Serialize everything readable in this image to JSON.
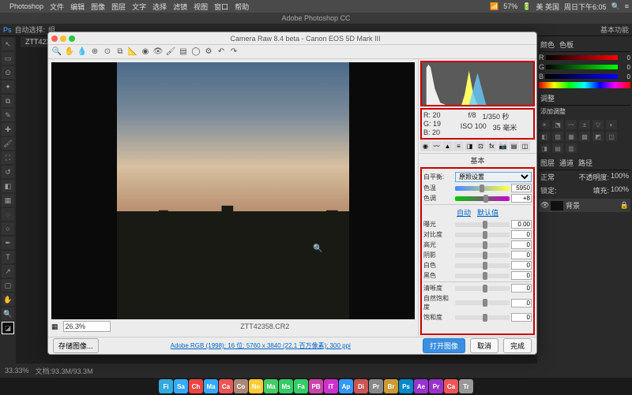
{
  "menubar": {
    "app": "Photoshop",
    "items": [
      "文件",
      "编辑",
      "图像",
      "图层",
      "文字",
      "选择",
      "滤镜",
      "视图",
      "窗口",
      "帮助"
    ],
    "battery": "57%",
    "locale": "美 英国",
    "datetime": "周日下午6:05"
  },
  "app": {
    "title": "Adobe Photoshop CC",
    "tab": "ZTT4235...",
    "toolbar_label": "自动选择:",
    "toolbar_mode": "组",
    "basic_label": "基本功能"
  },
  "status": {
    "zoom": "33.33%",
    "info": "文档:93.3M/93.3M"
  },
  "right": {
    "tabs": [
      "颜色",
      "色板"
    ],
    "rgb": {
      "r": "0",
      "g": "0",
      "b": "0"
    },
    "adj_header": "调整",
    "add_adj": "添加调整",
    "layer_tabs": [
      "图层",
      "通道",
      "路径"
    ],
    "normal": "正常",
    "opacity_lbl": "不透明度:",
    "opacity": "100%",
    "lock_lbl": "锁定:",
    "fill_lbl": "填充:",
    "fill": "100%",
    "layer_name": "背景",
    "lock": "🔒"
  },
  "cr": {
    "title": "Camera Raw 8.4 beta - Canon EOS 5D Mark III",
    "zoom": "26.3%",
    "filename": "ZTT42358.CR2",
    "meta": {
      "r": "20",
      "g": "19",
      "b": "20",
      "fstop": "f/8",
      "shutter": "1/350 秒",
      "iso": "ISO 100",
      "focal": "35 毫米"
    },
    "panel_title": "基本",
    "wb_label": "白平衡:",
    "wb_value": "原照设置",
    "sliders": {
      "temp": {
        "label": "色温",
        "value": "5950"
      },
      "tint": {
        "label": "色调",
        "value": "+8"
      },
      "auto": "自动",
      "default": "默认值",
      "exposure": {
        "label": "曝光",
        "value": "0.00"
      },
      "contrast": {
        "label": "对比度",
        "value": "0"
      },
      "highlights": {
        "label": "高光",
        "value": "0"
      },
      "shadows": {
        "label": "阴影",
        "value": "0"
      },
      "whites": {
        "label": "白色",
        "value": "0"
      },
      "blacks": {
        "label": "黑色",
        "value": "0"
      },
      "clarity": {
        "label": "清晰度",
        "value": "0"
      },
      "vibrance": {
        "label": "自然饱和度",
        "value": "0"
      },
      "saturation": {
        "label": "饱和度",
        "value": "0"
      }
    },
    "footer": {
      "save": "存储图像...",
      "profile": "Adobe RGB (1998); 16 位; 5760 x 3840 (22.1 百万像素); 300 ppi",
      "open": "打开图像",
      "cancel": "取消",
      "done": "完成"
    }
  },
  "dock": [
    "Finder",
    "Safari",
    "Chrome",
    "Mail",
    "Cal",
    "Contacts",
    "Notes",
    "Maps",
    "Msg",
    "FaceTime",
    "PB",
    "iTunes",
    "AppStore",
    "Dict",
    "Pref",
    "Br",
    "Ps",
    "Ae",
    "Pr",
    "Cal",
    "Trash"
  ],
  "dock_colors": [
    "#3ad",
    "#3af",
    "#e44",
    "#3af",
    "#e55",
    "#a87",
    "#fc3",
    "#4c6",
    "#3c6",
    "#3c6",
    "#c4a",
    "#c3c",
    "#39f",
    "#c55",
    "#888",
    "#c93",
    "#08c",
    "#93c",
    "#93c",
    "#e55",
    "#999"
  ]
}
